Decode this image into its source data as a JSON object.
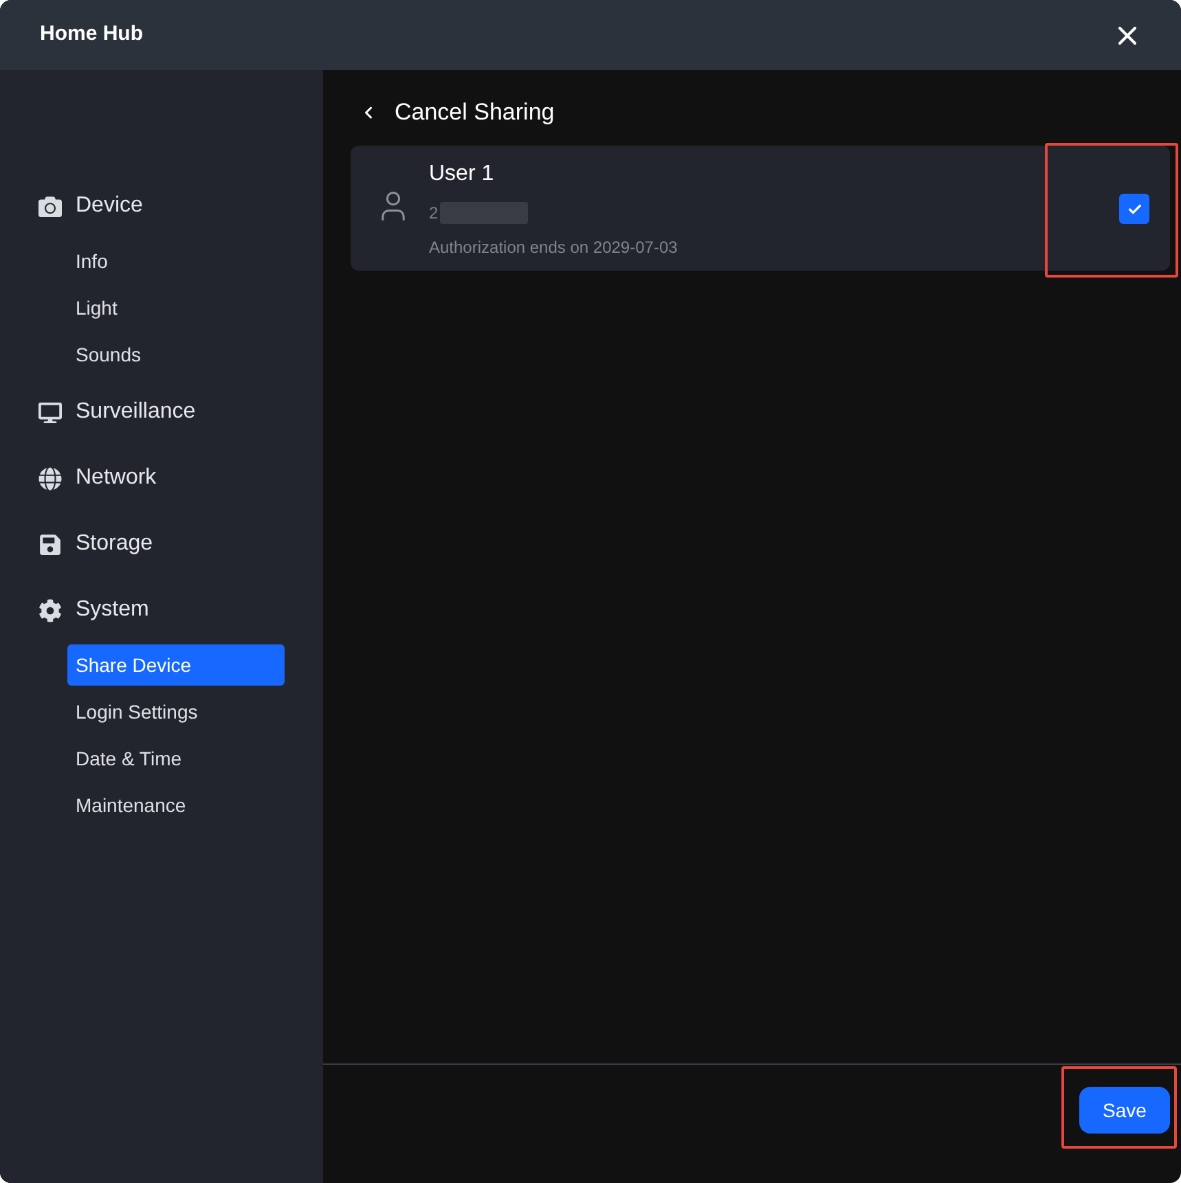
{
  "window": {
    "title": "Home Hub"
  },
  "sidebar": {
    "groups": [
      {
        "label": "Device",
        "items": [
          {
            "label": "Info",
            "selected": false
          },
          {
            "label": "Light",
            "selected": false
          },
          {
            "label": "Sounds",
            "selected": false
          }
        ]
      },
      {
        "label": "Surveillance"
      },
      {
        "label": "Network"
      },
      {
        "label": "Storage"
      },
      {
        "label": "System",
        "items": [
          {
            "label": "Share Device",
            "selected": true
          },
          {
            "label": "Login Settings",
            "selected": false
          },
          {
            "label": "Date & Time",
            "selected": false
          },
          {
            "label": "Maintenance",
            "selected": false
          }
        ]
      }
    ]
  },
  "page": {
    "title": "Cancel Sharing"
  },
  "users": [
    {
      "name": "User 1",
      "id": "2",
      "id_redacted": true,
      "note": "Authorization ends on 2029-07-03",
      "checked": true,
      "highlighted": true
    }
  ],
  "footer": {
    "save": {
      "label": "Save",
      "highlighted": true
    }
  }
}
